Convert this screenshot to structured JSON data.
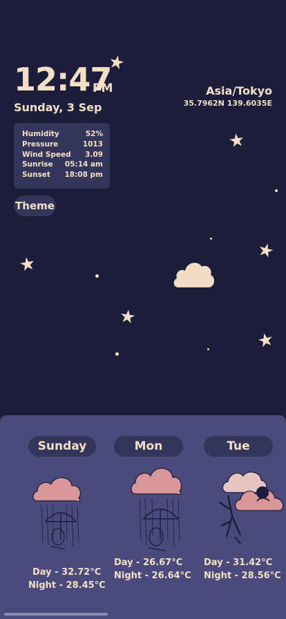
{
  "clock": {
    "time": "12:47",
    "ampm": "PM",
    "date": "Sunday, 3 Sep"
  },
  "location": {
    "name": "Asia/Tokyo",
    "coords": "35.7962N 139.6035E"
  },
  "stats": [
    {
      "label": "Humidity",
      "value": "52%"
    },
    {
      "label": "Pressure",
      "value": "1013"
    },
    {
      "label": "Wind Speed",
      "value": "3.09"
    },
    {
      "label": "Sunrise",
      "value": "05:14 am"
    },
    {
      "label": "Sunset",
      "value": "18:08 pm"
    }
  ],
  "theme_label": "Theme",
  "forecast": [
    {
      "day": "Sunday",
      "icon": "rain-umbrella-icon",
      "day_temp": "Day - 32.72°C",
      "night_temp": "Night - 28.45°C"
    },
    {
      "day": "Mon",
      "icon": "rain-umbrella-icon",
      "day_temp": "Day - 26.67°C",
      "night_temp": "Night - 26.64°C"
    },
    {
      "day": "Tue",
      "icon": "cloud-creature-icon",
      "day_temp": "Day - 31.42°C",
      "night_temp": "Night - 28.56°C"
    }
  ],
  "colors": {
    "background": "#1b1d3a",
    "panel": "#4a4b7c",
    "pill": "#34355a",
    "text": "#f3dfc6",
    "cloud": "#d9979a"
  }
}
